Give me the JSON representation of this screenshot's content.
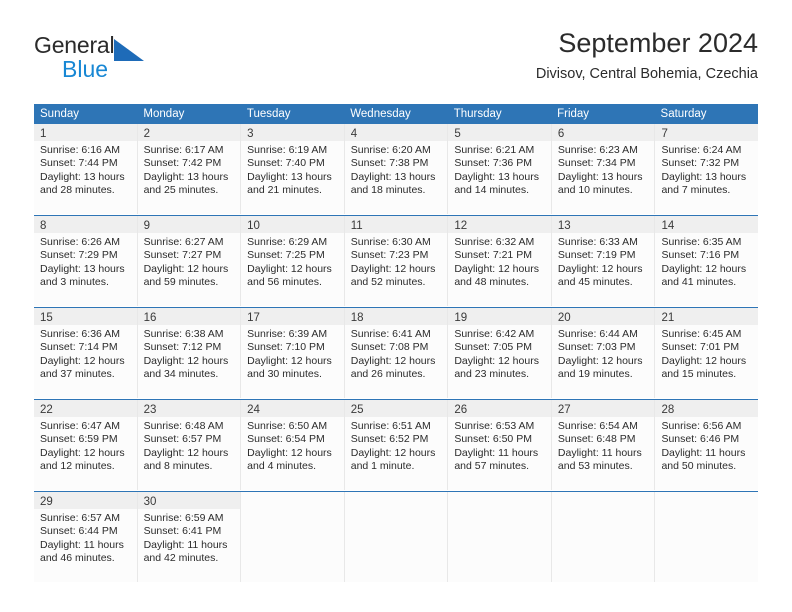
{
  "brand": {
    "name_top": "General",
    "name_bottom": "Blue",
    "accent_dark": "#1e6bb8",
    "accent_light": "#1787d4"
  },
  "header": {
    "title": "September 2024",
    "subtitle": "Divisov, Central Bohemia, Czechia"
  },
  "theme": {
    "header_blue": "#2e75b6",
    "daynum_band": "#efefef",
    "cell_bg": "#fcfcfc",
    "text": "#2b2b2b"
  },
  "weekdays": [
    {
      "label": "Sunday"
    },
    {
      "label": "Monday"
    },
    {
      "label": "Tuesday"
    },
    {
      "label": "Wednesday"
    },
    {
      "label": "Thursday"
    },
    {
      "label": "Friday"
    },
    {
      "label": "Saturday"
    }
  ],
  "weeks": [
    {
      "days": [
        {
          "num": "1",
          "sunrise": "Sunrise: 6:16 AM",
          "sunset": "Sunset: 7:44 PM",
          "daylight1": "Daylight: 13 hours",
          "daylight2": "and 28 minutes."
        },
        {
          "num": "2",
          "sunrise": "Sunrise: 6:17 AM",
          "sunset": "Sunset: 7:42 PM",
          "daylight1": "Daylight: 13 hours",
          "daylight2": "and 25 minutes."
        },
        {
          "num": "3",
          "sunrise": "Sunrise: 6:19 AM",
          "sunset": "Sunset: 7:40 PM",
          "daylight1": "Daylight: 13 hours",
          "daylight2": "and 21 minutes."
        },
        {
          "num": "4",
          "sunrise": "Sunrise: 6:20 AM",
          "sunset": "Sunset: 7:38 PM",
          "daylight1": "Daylight: 13 hours",
          "daylight2": "and 18 minutes."
        },
        {
          "num": "5",
          "sunrise": "Sunrise: 6:21 AM",
          "sunset": "Sunset: 7:36 PM",
          "daylight1": "Daylight: 13 hours",
          "daylight2": "and 14 minutes."
        },
        {
          "num": "6",
          "sunrise": "Sunrise: 6:23 AM",
          "sunset": "Sunset: 7:34 PM",
          "daylight1": "Daylight: 13 hours",
          "daylight2": "and 10 minutes."
        },
        {
          "num": "7",
          "sunrise": "Sunrise: 6:24 AM",
          "sunset": "Sunset: 7:32 PM",
          "daylight1": "Daylight: 13 hours",
          "daylight2": "and 7 minutes."
        }
      ]
    },
    {
      "days": [
        {
          "num": "8",
          "sunrise": "Sunrise: 6:26 AM",
          "sunset": "Sunset: 7:29 PM",
          "daylight1": "Daylight: 13 hours",
          "daylight2": "and 3 minutes."
        },
        {
          "num": "9",
          "sunrise": "Sunrise: 6:27 AM",
          "sunset": "Sunset: 7:27 PM",
          "daylight1": "Daylight: 12 hours",
          "daylight2": "and 59 minutes."
        },
        {
          "num": "10",
          "sunrise": "Sunrise: 6:29 AM",
          "sunset": "Sunset: 7:25 PM",
          "daylight1": "Daylight: 12 hours",
          "daylight2": "and 56 minutes."
        },
        {
          "num": "11",
          "sunrise": "Sunrise: 6:30 AM",
          "sunset": "Sunset: 7:23 PM",
          "daylight1": "Daylight: 12 hours",
          "daylight2": "and 52 minutes."
        },
        {
          "num": "12",
          "sunrise": "Sunrise: 6:32 AM",
          "sunset": "Sunset: 7:21 PM",
          "daylight1": "Daylight: 12 hours",
          "daylight2": "and 48 minutes."
        },
        {
          "num": "13",
          "sunrise": "Sunrise: 6:33 AM",
          "sunset": "Sunset: 7:19 PM",
          "daylight1": "Daylight: 12 hours",
          "daylight2": "and 45 minutes."
        },
        {
          "num": "14",
          "sunrise": "Sunrise: 6:35 AM",
          "sunset": "Sunset: 7:16 PM",
          "daylight1": "Daylight: 12 hours",
          "daylight2": "and 41 minutes."
        }
      ]
    },
    {
      "days": [
        {
          "num": "15",
          "sunrise": "Sunrise: 6:36 AM",
          "sunset": "Sunset: 7:14 PM",
          "daylight1": "Daylight: 12 hours",
          "daylight2": "and 37 minutes."
        },
        {
          "num": "16",
          "sunrise": "Sunrise: 6:38 AM",
          "sunset": "Sunset: 7:12 PM",
          "daylight1": "Daylight: 12 hours",
          "daylight2": "and 34 minutes."
        },
        {
          "num": "17",
          "sunrise": "Sunrise: 6:39 AM",
          "sunset": "Sunset: 7:10 PM",
          "daylight1": "Daylight: 12 hours",
          "daylight2": "and 30 minutes."
        },
        {
          "num": "18",
          "sunrise": "Sunrise: 6:41 AM",
          "sunset": "Sunset: 7:08 PM",
          "daylight1": "Daylight: 12 hours",
          "daylight2": "and 26 minutes."
        },
        {
          "num": "19",
          "sunrise": "Sunrise: 6:42 AM",
          "sunset": "Sunset: 7:05 PM",
          "daylight1": "Daylight: 12 hours",
          "daylight2": "and 23 minutes."
        },
        {
          "num": "20",
          "sunrise": "Sunrise: 6:44 AM",
          "sunset": "Sunset: 7:03 PM",
          "daylight1": "Daylight: 12 hours",
          "daylight2": "and 19 minutes."
        },
        {
          "num": "21",
          "sunrise": "Sunrise: 6:45 AM",
          "sunset": "Sunset: 7:01 PM",
          "daylight1": "Daylight: 12 hours",
          "daylight2": "and 15 minutes."
        }
      ]
    },
    {
      "days": [
        {
          "num": "22",
          "sunrise": "Sunrise: 6:47 AM",
          "sunset": "Sunset: 6:59 PM",
          "daylight1": "Daylight: 12 hours",
          "daylight2": "and 12 minutes."
        },
        {
          "num": "23",
          "sunrise": "Sunrise: 6:48 AM",
          "sunset": "Sunset: 6:57 PM",
          "daylight1": "Daylight: 12 hours",
          "daylight2": "and 8 minutes."
        },
        {
          "num": "24",
          "sunrise": "Sunrise: 6:50 AM",
          "sunset": "Sunset: 6:54 PM",
          "daylight1": "Daylight: 12 hours",
          "daylight2": "and 4 minutes."
        },
        {
          "num": "25",
          "sunrise": "Sunrise: 6:51 AM",
          "sunset": "Sunset: 6:52 PM",
          "daylight1": "Daylight: 12 hours",
          "daylight2": "and 1 minute."
        },
        {
          "num": "26",
          "sunrise": "Sunrise: 6:53 AM",
          "sunset": "Sunset: 6:50 PM",
          "daylight1": "Daylight: 11 hours",
          "daylight2": "and 57 minutes."
        },
        {
          "num": "27",
          "sunrise": "Sunrise: 6:54 AM",
          "sunset": "Sunset: 6:48 PM",
          "daylight1": "Daylight: 11 hours",
          "daylight2": "and 53 minutes."
        },
        {
          "num": "28",
          "sunrise": "Sunrise: 6:56 AM",
          "sunset": "Sunset: 6:46 PM",
          "daylight1": "Daylight: 11 hours",
          "daylight2": "and 50 minutes."
        }
      ]
    },
    {
      "days": [
        {
          "num": "29",
          "sunrise": "Sunrise: 6:57 AM",
          "sunset": "Sunset: 6:44 PM",
          "daylight1": "Daylight: 11 hours",
          "daylight2": "and 46 minutes."
        },
        {
          "num": "30",
          "sunrise": "Sunrise: 6:59 AM",
          "sunset": "Sunset: 6:41 PM",
          "daylight1": "Daylight: 11 hours",
          "daylight2": "and 42 minutes."
        },
        {
          "num": "",
          "sunrise": "",
          "sunset": "",
          "daylight1": "",
          "daylight2": ""
        },
        {
          "num": "",
          "sunrise": "",
          "sunset": "",
          "daylight1": "",
          "daylight2": ""
        },
        {
          "num": "",
          "sunrise": "",
          "sunset": "",
          "daylight1": "",
          "daylight2": ""
        },
        {
          "num": "",
          "sunrise": "",
          "sunset": "",
          "daylight1": "",
          "daylight2": ""
        },
        {
          "num": "",
          "sunrise": "",
          "sunset": "",
          "daylight1": "",
          "daylight2": ""
        }
      ]
    }
  ]
}
